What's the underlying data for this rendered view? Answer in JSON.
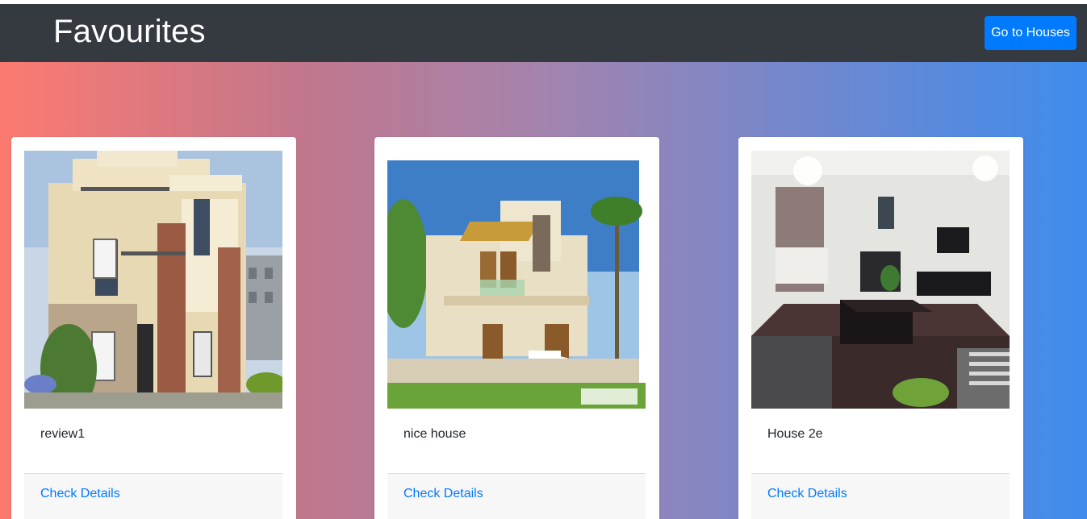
{
  "navbar": {
    "title": "Favourites",
    "go_button": "Go to Houses"
  },
  "cards": [
    {
      "title": "review1",
      "link": "Check Details",
      "image": "modern-multistorey-house-photo"
    },
    {
      "title": "nice house",
      "link": "Check Details",
      "image": "two-storey-house-with-car-photo"
    },
    {
      "title": "House 2e",
      "link": "Check Details",
      "image": "living-room-interior-photo"
    }
  ],
  "colors": {
    "navbar": "#343a40",
    "primary": "#007bff",
    "gradient_left": "#fc7a70",
    "gradient_right": "#3f8cec"
  }
}
